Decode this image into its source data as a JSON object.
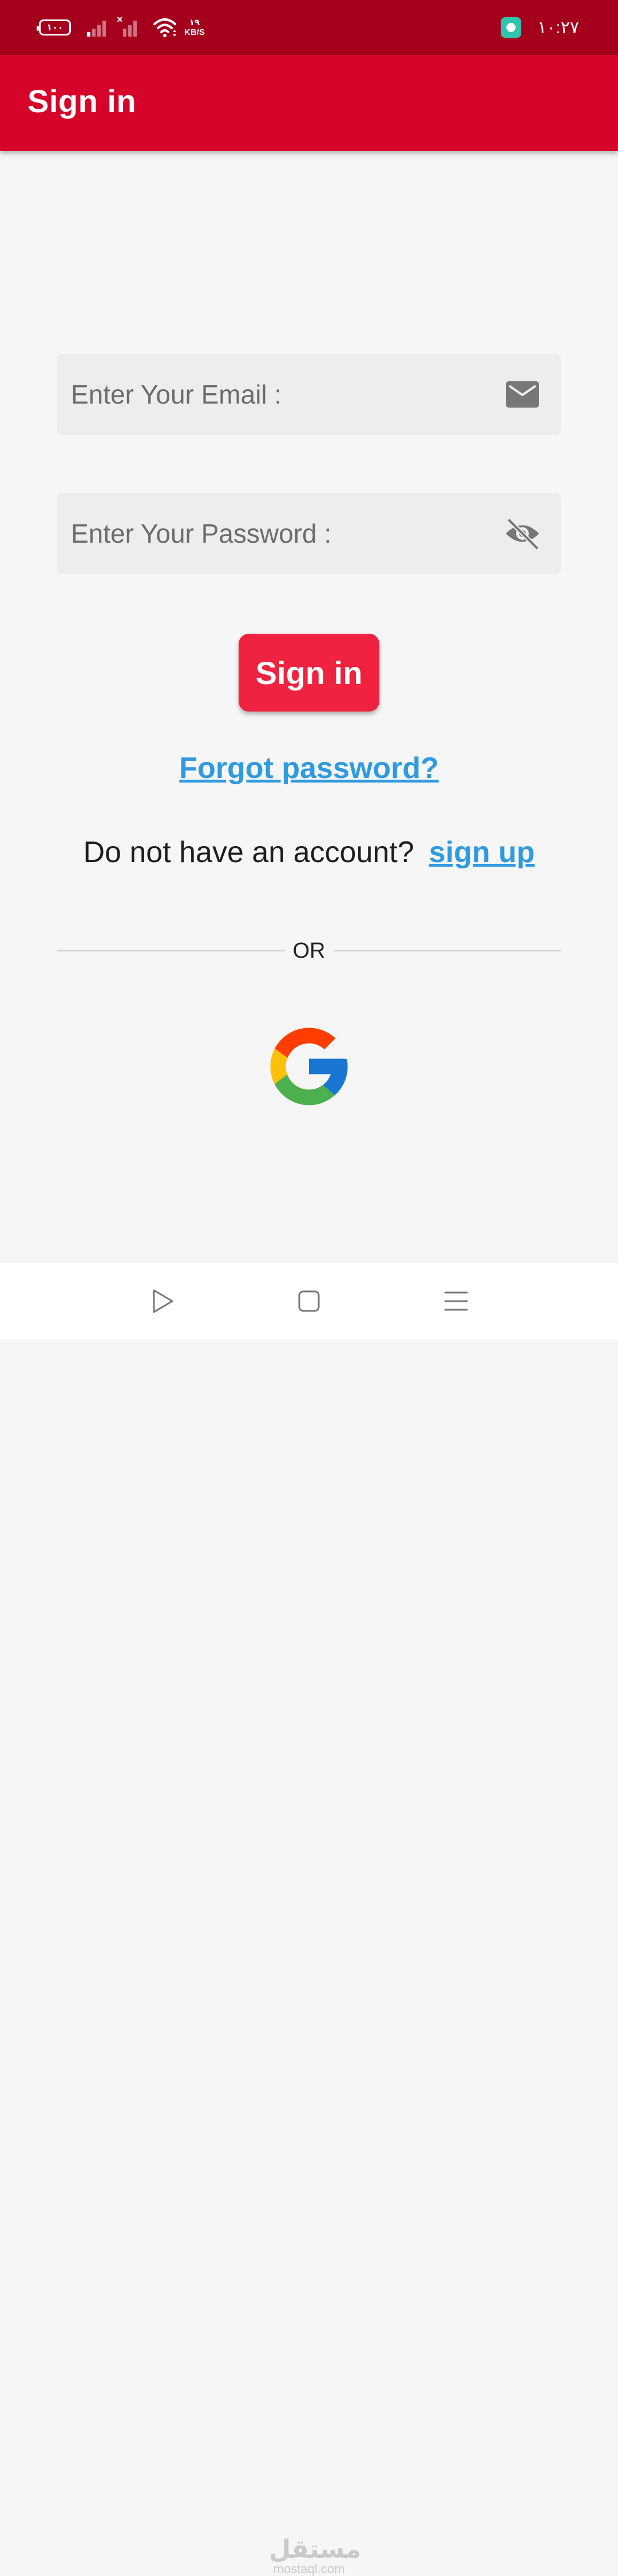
{
  "status_bar": {
    "battery": "١٠٠",
    "net_speed_value": "١٩",
    "net_speed_unit": "KB/S",
    "signal_disabled_mark": "×",
    "time": "١٠:٢٧"
  },
  "app_bar": {
    "title": "Sign in"
  },
  "form": {
    "email_placeholder": "Enter Your Email :",
    "email_value": "",
    "password_placeholder": "Enter Your Password :",
    "password_value": "",
    "signin_label": "Sign in",
    "forgot_label": "Forgot password?",
    "no_account_text": "Do not have an account?",
    "signup_label": "sign up",
    "or_label": "OR"
  },
  "icons": {
    "email": "mail-icon",
    "password_toggle": "eye-off-icon",
    "google": "google-icon",
    "nav_back": "back-triangle-icon",
    "nav_home": "home-square-icon",
    "nav_menu": "menu-lines-icon"
  },
  "watermark": {
    "arabic": "مستقل",
    "latin": "mostaql.com"
  },
  "colors": {
    "status_bar": "#a4001d",
    "app_bar": "#d6032a",
    "primary_button": "#ef2340",
    "link": "#2f9ae0",
    "background": "#f6f6f6",
    "field": "#ededed"
  }
}
